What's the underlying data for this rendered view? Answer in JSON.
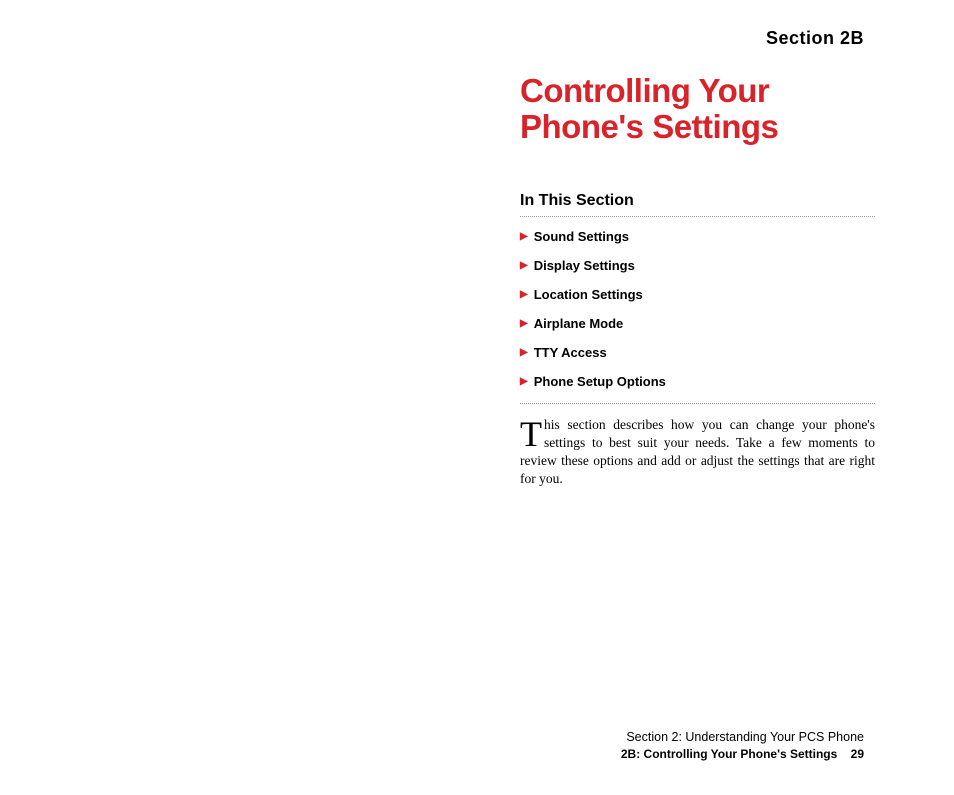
{
  "header": {
    "section_label": "Section 2B"
  },
  "title": "Controlling Your Phone's Settings",
  "subsection": {
    "heading": "In This Section",
    "items": [
      "Sound Settings",
      "Display Settings",
      "Location Settings",
      "Airplane Mode",
      "TTY Access",
      "Phone Setup Options"
    ]
  },
  "body": {
    "dropcap": "T",
    "text": "his section describes how you can change your phone's settings to best suit your needs. Take a few moments to review these options and add or adjust the settings that are right for you."
  },
  "footer": {
    "line1": "Section 2: Understanding Your PCS Phone",
    "line2_label": "2B: Controlling Your Phone's Settings",
    "page_number": "29"
  }
}
